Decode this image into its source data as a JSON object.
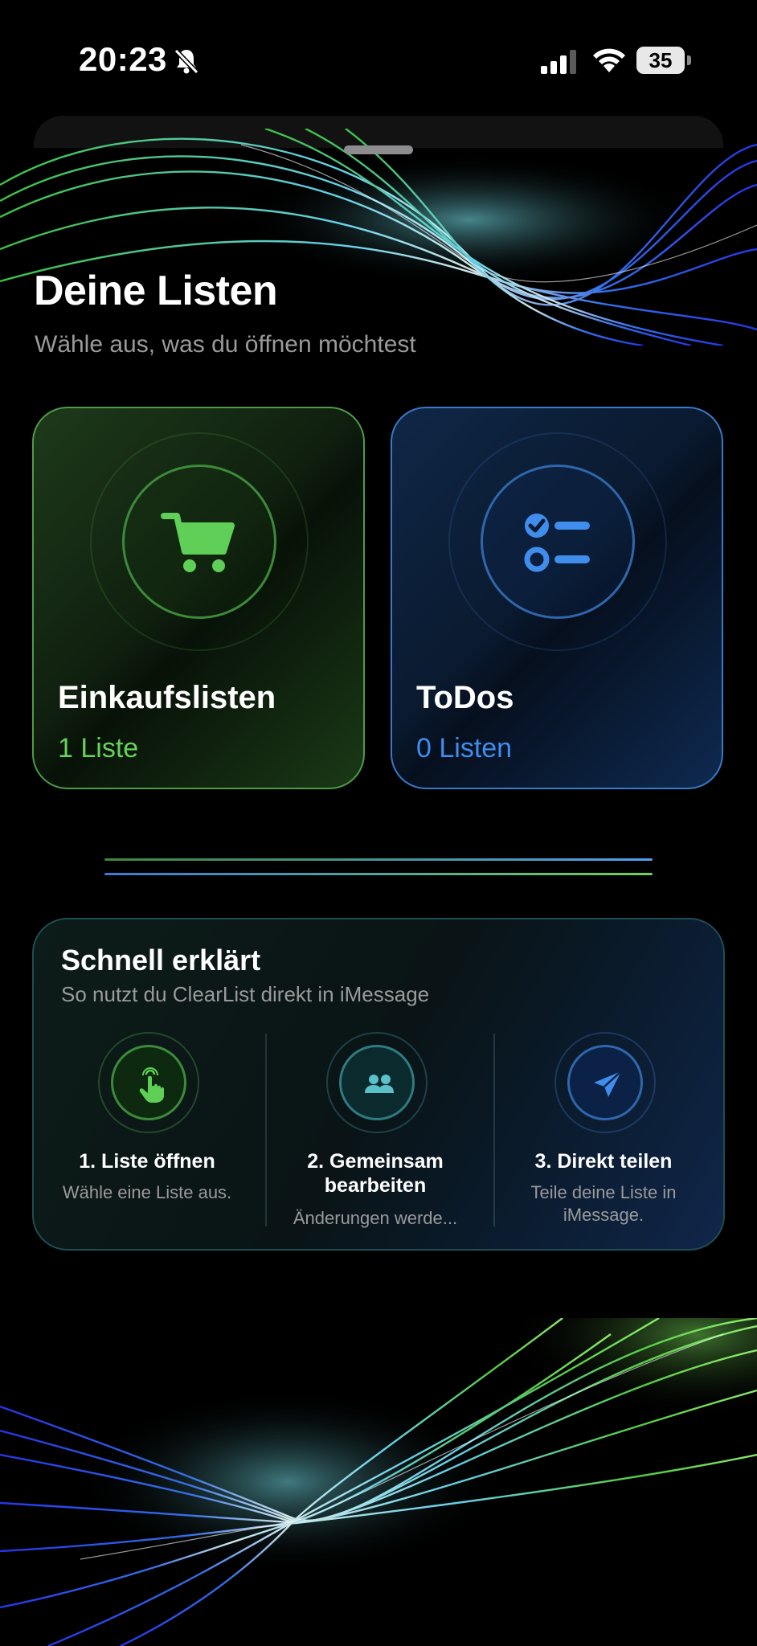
{
  "status_bar": {
    "time": "20:23",
    "battery_level": "35",
    "battery_fraction": 0.35,
    "icons": [
      "bell-slash-icon",
      "cellular-signal-icon",
      "wifi-icon",
      "battery-icon"
    ]
  },
  "header": {
    "title": "Deine Listen",
    "subtitle": "Wähle aus, was du öffnen möchtest"
  },
  "cards": {
    "shopping": {
      "icon": "shopping-cart-icon",
      "title": "Einkaufslisten",
      "count": "1 Liste",
      "accent": "#67d25a"
    },
    "todos": {
      "icon": "checklist-icon",
      "title": "ToDos",
      "count": "0 Listen",
      "accent": "#3f8dec"
    }
  },
  "quick_guide": {
    "title": "Schnell erklärt",
    "subtitle": "So nutzt du ClearList direkt in iMessage",
    "steps": [
      {
        "icon": "hand-tap-icon",
        "title": "1. Liste öffnen",
        "text": "Wähle eine Liste aus.",
        "accent": "#5fcf57"
      },
      {
        "icon": "people-icon",
        "title": "2. Gemeinsam bearbeiten",
        "text": "Änderungen werde...",
        "accent": "#5bc0c8"
      },
      {
        "icon": "paper-plane-icon",
        "title": "3. Direkt teilen",
        "text": "Teile deine Liste in iMessage.",
        "accent": "#3f8dec"
      }
    ]
  },
  "colors": {
    "background": "#000000",
    "green": "#67d25a",
    "blue": "#3f8dec",
    "teal": "#5bc0c8",
    "subtitle_gray": "#9a9a9a"
  }
}
